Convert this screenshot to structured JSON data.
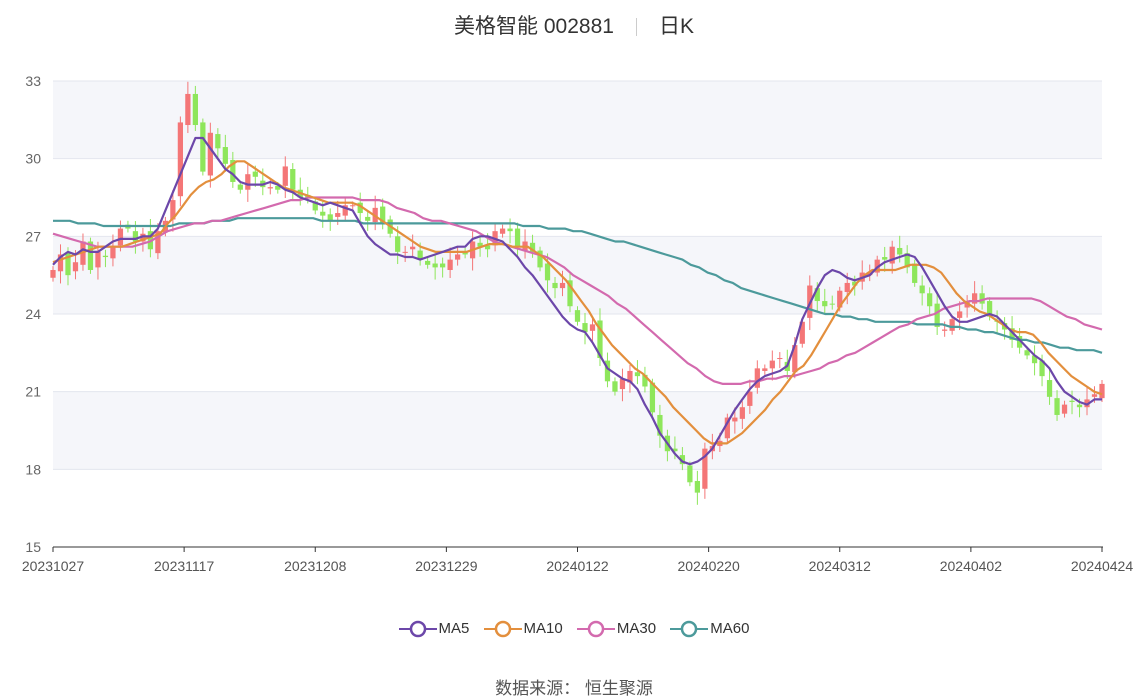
{
  "title": {
    "stock": "美格智能 002881",
    "period": "日K"
  },
  "source": {
    "label": "数据来源：",
    "value": "恒生聚源"
  },
  "colors": {
    "up": "#f47677",
    "down": "#8ee65b",
    "ma5": "#6c47a9",
    "ma10": "#e38f3d",
    "ma30": "#d36aae",
    "ma60": "#4c9a9b"
  },
  "chart_data": {
    "type": "candlestick",
    "title": "美格智能 002881 日K",
    "ylim": [
      15,
      33
    ],
    "yticks": [
      "15",
      "18",
      "21",
      "24",
      "27",
      "30",
      "33"
    ],
    "xticks": [
      "20231027",
      "20231117",
      "20231208",
      "20231229",
      "20240122",
      "20240220",
      "20240312",
      "20240402",
      "20240424"
    ],
    "legend": [
      "MA5",
      "MA10",
      "MA30",
      "MA60"
    ],
    "close_approx": [
      25.7,
      26.3,
      25.5,
      26.0,
      26.8,
      25.7,
      26.4,
      26.2,
      26.6,
      27.3,
      27.3,
      26.8,
      27.1,
      26.5,
      27.2,
      27.6,
      28.4,
      31.4,
      32.5,
      31.3,
      29.5,
      31.0,
      30.4,
      29.8,
      29.1,
      28.8,
      29.4,
      29.3,
      28.9,
      28.9,
      28.8,
      29.7,
      28.8,
      28.5,
      28.5,
      28.0,
      27.8,
      27.6,
      27.9,
      28.2,
      28.2,
      27.9,
      27.6,
      28.1,
      27.5,
      27.1,
      26.4,
      26.4,
      26.6,
      26.1,
      25.9,
      25.8,
      25.8,
      26.1,
      26.3,
      26.3,
      26.8,
      26.6,
      26.5,
      27.2,
      27.3,
      27.2,
      26.6,
      26.8,
      26.4,
      25.8,
      25.3,
      25.0,
      25.2,
      24.3,
      23.7,
      23.3,
      23.6,
      22.3,
      21.4,
      21.0,
      21.5,
      21.8,
      21.6,
      21.2,
      20.2,
      19.3,
      18.7,
      18.7,
      18.2,
      17.5,
      17.1,
      18.8,
      18.9,
      19.1,
      20.0,
      20.0,
      20.4,
      21.0,
      21.9,
      21.9,
      22.2,
      22.3,
      21.8,
      22.8,
      23.7,
      25.1,
      24.5,
      24.3,
      24.4,
      24.9,
      25.2,
      25.1,
      25.6,
      25.6,
      26.1,
      26.1,
      26.6,
      26.3,
      25.8,
      25.2,
      24.8,
      24.3,
      23.5,
      23.4,
      23.8,
      24.1,
      24.5,
      24.8,
      24.4,
      23.9,
      23.7,
      23.4,
      23.0,
      22.7,
      22.4,
      22.1,
      21.6,
      20.8,
      20.1,
      20.5,
      20.6,
      20.4,
      20.7,
      20.9,
      21.3
    ],
    "ma5": [
      25.9,
      26.2,
      26.4,
      26.3,
      26.5,
      26.4,
      26.4,
      26.6,
      26.8,
      26.9,
      26.9,
      26.9,
      27.0,
      27.0,
      27.3,
      28.0,
      28.7,
      29.4,
      30.1,
      30.8,
      30.8,
      30.4,
      30.0,
      29.6,
      29.4,
      29.1,
      29.0,
      29.0,
      29.0,
      29.1,
      29.0,
      28.8,
      28.7,
      28.5,
      28.4,
      28.3,
      28.2,
      28.3,
      28.2,
      28.1,
      28.0,
      27.5,
      27.0,
      26.7,
      26.5,
      26.3,
      26.3,
      26.2,
      26.2,
      26.1,
      26.2,
      26.3,
      26.4,
      26.5,
      26.6,
      26.6,
      26.9,
      27.0,
      27.0,
      26.9,
      26.8,
      26.5,
      26.2,
      25.8,
      25.5,
      25.1,
      24.7,
      24.3,
      23.9,
      23.6,
      23.4,
      23.3,
      22.9,
      22.4,
      21.9,
      21.7,
      21.5,
      21.4,
      21.1,
      20.5,
      20.0,
      19.4,
      19.0,
      18.6,
      18.3,
      18.2,
      18.3,
      18.5,
      18.8,
      19.3,
      19.8,
      20.3,
      20.7,
      21.1,
      21.4,
      21.6,
      21.7,
      21.8,
      22.0,
      22.8,
      23.8,
      24.4,
      25.0,
      25.5,
      25.7,
      25.6,
      25.4,
      25.3,
      25.4,
      25.5,
      25.8,
      26.0,
      26.1,
      26.2,
      26.3,
      26.2,
      25.8,
      25.3,
      24.8,
      24.3,
      23.9,
      23.7,
      23.7,
      23.8,
      23.9,
      24.0,
      23.9,
      23.6,
      23.3,
      23.0,
      22.7,
      22.4,
      22.2,
      21.9,
      21.4,
      21.0,
      20.8,
      20.6,
      20.5,
      20.7,
      20.7
    ],
    "ma10": [
      26.0,
      26.1,
      26.2,
      26.3,
      26.4,
      26.5,
      26.6,
      26.6,
      26.6,
      26.6,
      26.7,
      26.8,
      26.9,
      27.0,
      27.1,
      27.5,
      27.8,
      28.2,
      28.6,
      28.9,
      29.1,
      29.2,
      29.4,
      29.7,
      29.9,
      29.9,
      29.7,
      29.5,
      29.3,
      29.1,
      28.9,
      28.8,
      28.7,
      28.6,
      28.5,
      28.4,
      28.3,
      28.3,
      28.3,
      28.3,
      28.2,
      28.0,
      27.8,
      27.6,
      27.4,
      27.2,
      27.0,
      26.8,
      26.6,
      26.5,
      26.4,
      26.4,
      26.4,
      26.4,
      26.4,
      26.5,
      26.6,
      26.7,
      26.7,
      26.7,
      26.6,
      26.6,
      26.6,
      26.4,
      26.2,
      25.9,
      25.6,
      25.3,
      24.9,
      24.5,
      24.1,
      23.6,
      23.2,
      22.8,
      22.5,
      22.2,
      21.9,
      21.7,
      21.4,
      21.1,
      20.8,
      20.4,
      20.1,
      19.8,
      19.5,
      19.2,
      19.0,
      19.0,
      19.0,
      19.2,
      19.4,
      19.7,
      20.0,
      20.3,
      20.7,
      21.0,
      21.4,
      21.8,
      22.0,
      22.4,
      22.9,
      23.4,
      23.9,
      24.4,
      24.8,
      25.2,
      25.5,
      25.7,
      25.7,
      25.7,
      25.7,
      25.8,
      25.9,
      25.9,
      25.9,
      25.8,
      25.6,
      25.2,
      24.8,
      24.5,
      24.3,
      24.1,
      24.0,
      23.8,
      23.6,
      23.4,
      23.3,
      23.3,
      23.2,
      22.9,
      22.5,
      22.2,
      21.9,
      21.6,
      21.4,
      21.2,
      21.0,
      20.9
    ],
    "ma30": [
      27.1,
      27.0,
      26.9,
      26.8,
      26.7,
      26.6,
      26.6,
      26.6,
      26.6,
      26.6,
      26.7,
      26.8,
      27.0,
      27.2,
      27.3,
      27.4,
      27.5,
      27.5,
      27.6,
      27.6,
      27.7,
      27.8,
      27.9,
      28.0,
      28.1,
      28.2,
      28.3,
      28.4,
      28.4,
      28.5,
      28.5,
      28.5,
      28.5,
      28.5,
      28.5,
      28.4,
      28.4,
      28.4,
      28.3,
      28.1,
      28.0,
      27.9,
      27.7,
      27.6,
      27.6,
      27.5,
      27.4,
      27.3,
      27.2,
      27.0,
      26.8,
      26.7,
      26.6,
      26.5,
      26.4,
      26.3,
      26.2,
      26.0,
      25.8,
      25.5,
      25.3,
      25.1,
      24.9,
      24.7,
      24.4,
      24.2,
      23.9,
      23.6,
      23.3,
      23.0,
      22.7,
      22.4,
      22.1,
      21.9,
      21.6,
      21.4,
      21.3,
      21.3,
      21.3,
      21.4,
      21.4,
      21.5,
      21.5,
      21.6,
      21.6,
      21.7,
      21.8,
      21.9,
      22.1,
      22.2,
      22.4,
      22.5,
      22.7,
      22.9,
      23.1,
      23.3,
      23.5,
      23.6,
      23.8,
      23.9,
      24.0,
      24.2,
      24.3,
      24.4,
      24.5,
      24.5,
      24.6,
      24.6,
      24.6,
      24.6,
      24.6,
      24.6,
      24.5,
      24.3,
      24.1,
      23.9,
      23.8,
      23.6,
      23.5,
      23.4
    ],
    "ma60": [
      27.6,
      27.6,
      27.6,
      27.5,
      27.5,
      27.5,
      27.4,
      27.4,
      27.4,
      27.4,
      27.4,
      27.4,
      27.4,
      27.4,
      27.4,
      27.5,
      27.5,
      27.5,
      27.5,
      27.6,
      27.6,
      27.6,
      27.7,
      27.7,
      27.7,
      27.7,
      27.7,
      27.7,
      27.7,
      27.7,
      27.7,
      27.7,
      27.6,
      27.6,
      27.6,
      27.6,
      27.6,
      27.5,
      27.5,
      27.5,
      27.5,
      27.5,
      27.5,
      27.5,
      27.5,
      27.5,
      27.5,
      27.5,
      27.5,
      27.5,
      27.5,
      27.5,
      27.5,
      27.5,
      27.5,
      27.5,
      27.4,
      27.4,
      27.4,
      27.3,
      27.3,
      27.3,
      27.2,
      27.2,
      27.1,
      27.0,
      26.9,
      26.8,
      26.8,
      26.7,
      26.6,
      26.5,
      26.4,
      26.3,
      26.2,
      26.1,
      25.9,
      25.8,
      25.6,
      25.5,
      25.3,
      25.2,
      25.0,
      24.9,
      24.8,
      24.7,
      24.6,
      24.5,
      24.4,
      24.3,
      24.2,
      24.1,
      24.0,
      24.0,
      23.9,
      23.9,
      23.8,
      23.8,
      23.7,
      23.7,
      23.7,
      23.7,
      23.7,
      23.6,
      23.6,
      23.6,
      23.6,
      23.5,
      23.5,
      23.4,
      23.4,
      23.3,
      23.3,
      23.2,
      23.1,
      23.0,
      23.0,
      22.9,
      22.9,
      22.8,
      22.7,
      22.7,
      22.6,
      22.6,
      22.6,
      22.5
    ]
  }
}
